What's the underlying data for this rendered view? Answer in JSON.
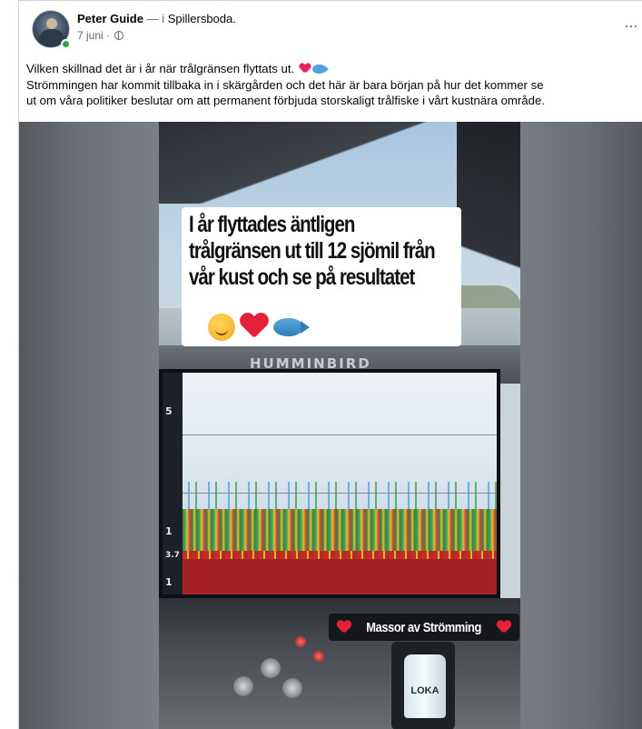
{
  "post": {
    "author_name": "Peter Guide",
    "separator": " — i ",
    "place": "Spillersboda.",
    "date": "7 juni · ",
    "more_label": "···",
    "text_lines": [
      "Vilken skillnad det är i år när trålgränsen flyttats ut. ",
      "Strömmingen har kommit tillbaka in i skärgården och det här är bara början på hur det kommer se",
      "ut om våra politiker beslutar om att permanent förbjuda storskaligt trålfiske i vårt kustnära område."
    ],
    "text_emojis": [
      "heart-emoji",
      "fish-emoji"
    ]
  },
  "media": {
    "brand_label": "HUMMINBIRD",
    "sticker_text": "I år flyttades äntligen\ntrålgränsen ut till 12 sjömil från\nvår kust och se på resultatet",
    "sticker_emojis": [
      "hugging-face-emoji",
      "heart-emoji",
      "fish-emoji"
    ],
    "caption": "Massor av Strömming",
    "bottle_label": "LOKA",
    "sonar_scale": [
      "5",
      "1",
      "3.7",
      "1"
    ]
  },
  "colors": {
    "online": "#31a24c",
    "heart": "#e3223a",
    "sonar_bottom": "#a42125"
  }
}
